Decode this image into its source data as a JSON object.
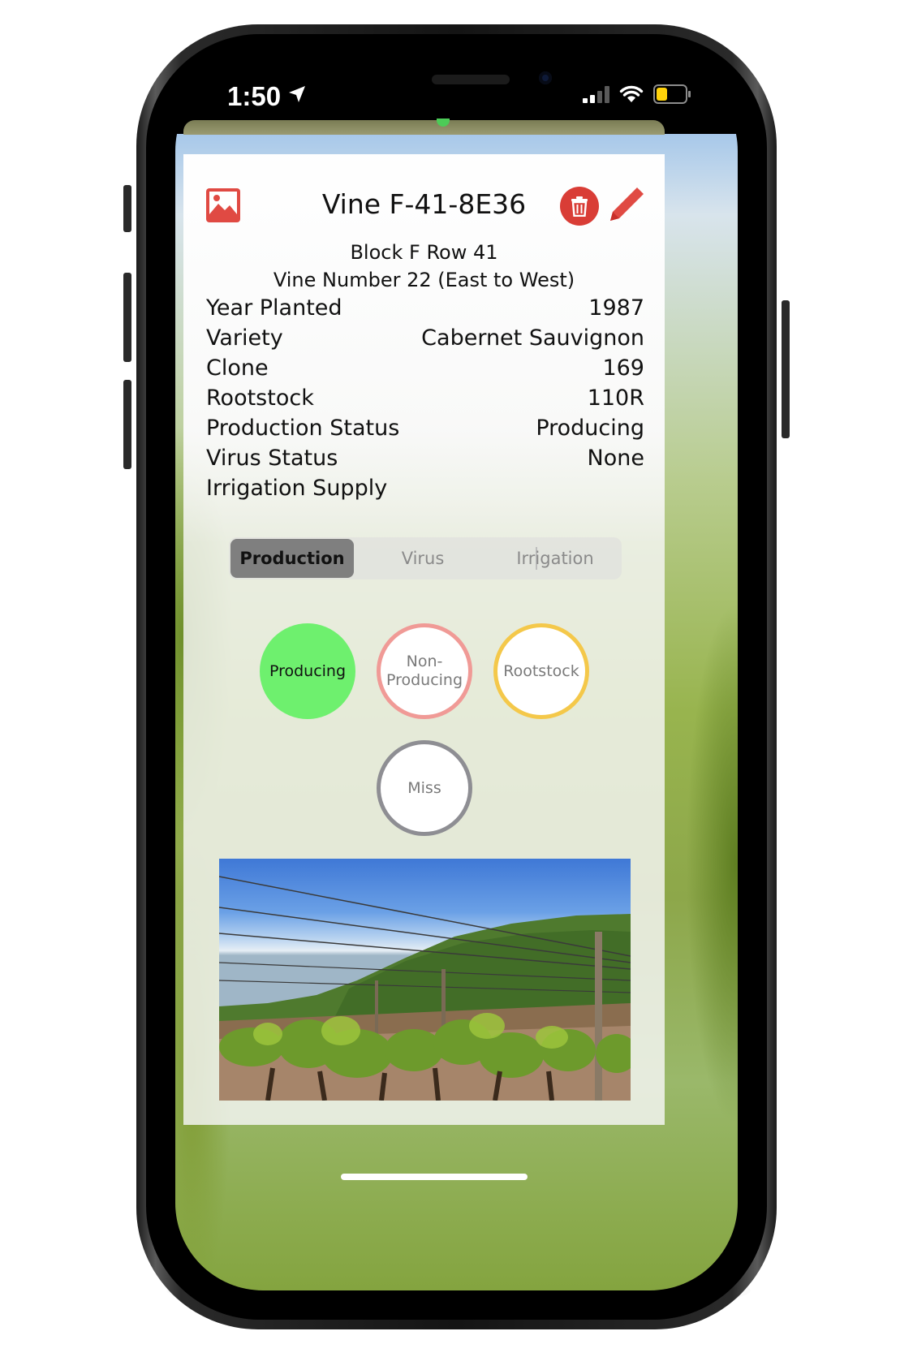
{
  "status_bar": {
    "time": "1:50"
  },
  "vine": {
    "title": "Vine F-41-8E36",
    "block_row": "Block F Row 41",
    "vine_number": "Vine Number 22 (East to West)"
  },
  "details": [
    {
      "label": "Year Planted",
      "value": "1987"
    },
    {
      "label": "Variety",
      "value": "Cabernet Sauvignon"
    },
    {
      "label": "Clone",
      "value": "169"
    },
    {
      "label": "Rootstock",
      "value": "110R"
    },
    {
      "label": "Production Status",
      "value": "Producing"
    },
    {
      "label": "Virus Status",
      "value": "None"
    },
    {
      "label": "Irrigation Supply",
      "value": ""
    }
  ],
  "tabs": [
    "Production",
    "Virus",
    "Irrigation"
  ],
  "selected_tab": "Production",
  "status_options": {
    "producing": "Producing",
    "non_producing_line1": "Non-",
    "non_producing_line2": "Producing",
    "rootstock": "Rootstock",
    "miss": "Miss"
  },
  "selected_status": "Producing",
  "colors": {
    "producing": "#6ef06e",
    "non_producing": "#f09a96",
    "rootstock": "#f4c84a",
    "miss": "#8e8e93",
    "delete": "#d93d36",
    "accent": "#e04a43"
  }
}
